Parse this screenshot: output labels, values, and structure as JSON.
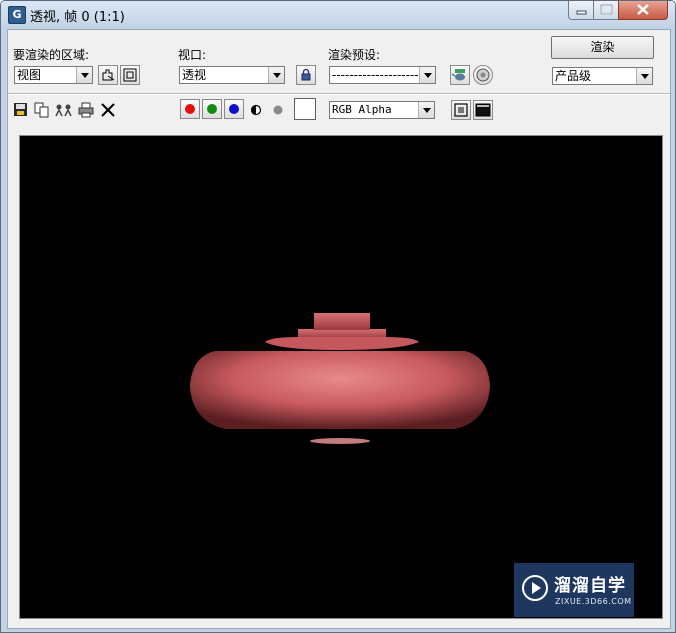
{
  "window": {
    "title": "透视, 帧 0 (1:1)",
    "app_icon": "G"
  },
  "render_area": {
    "label": "要渲染的区域:",
    "value": "视图"
  },
  "viewport_select": {
    "label": "视口:",
    "value": "透视"
  },
  "render_preset": {
    "label": "渲染预设:",
    "value": "--------------------"
  },
  "render_button": {
    "label": "渲染"
  },
  "production": {
    "value": "产品级"
  },
  "channel": {
    "value": "RGB Alpha"
  },
  "colors": {
    "red_channel": "#e01010",
    "green_channel": "#128a12",
    "blue_channel": "#1010c8",
    "render_object": "#c85a5e",
    "watermark_bg": "#2c4a7a"
  },
  "watermark": {
    "name": "溜溜自学",
    "url": "ZIXUE.3D66.COM"
  }
}
